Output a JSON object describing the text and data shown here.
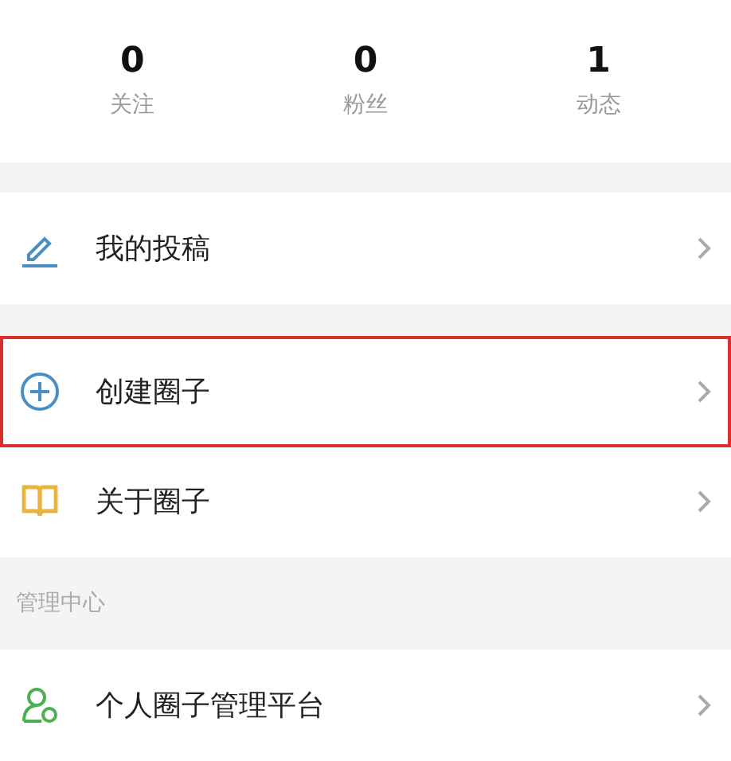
{
  "stats": [
    {
      "value": "0",
      "label": "关注"
    },
    {
      "value": "0",
      "label": "粉丝"
    },
    {
      "value": "1",
      "label": "动态"
    }
  ],
  "groups": [
    {
      "items": [
        {
          "kind": "pencil",
          "label": "我的投稿",
          "highlighted": false
        }
      ]
    },
    {
      "items": [
        {
          "kind": "plus",
          "label": "创建圈子",
          "highlighted": true
        },
        {
          "kind": "book",
          "label": "关于圈子",
          "highlighted": false
        }
      ]
    },
    {
      "title": "管理中心",
      "items": [
        {
          "kind": "person",
          "label": "个人圈子管理平台",
          "highlighted": false
        }
      ]
    }
  ]
}
